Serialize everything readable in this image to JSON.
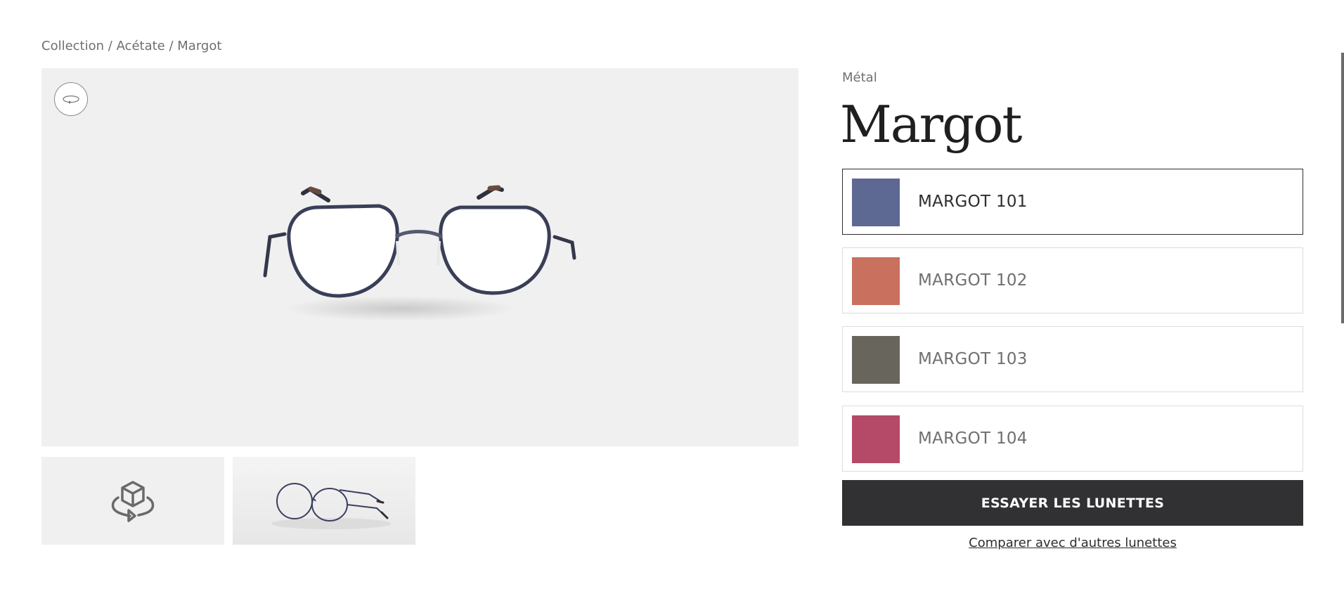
{
  "breadcrumb": {
    "items": [
      "Collection",
      "Acétate",
      "Margot"
    ],
    "separator": " / "
  },
  "viewer": {
    "rotate_icon": "rotate-360-icon",
    "product_icon": "glasses-3d-icon",
    "background": "#f0f0f0"
  },
  "thumbnails": [
    {
      "icon": "cube-rotate-icon"
    },
    {
      "icon": "glasses-photo-icon"
    }
  ],
  "product": {
    "material": "Métal",
    "title": "Margot"
  },
  "variants": [
    {
      "label": "MARGOT 101",
      "color": "#5d6893",
      "selected": true
    },
    {
      "label": "MARGOT 102",
      "color": "#c9705f",
      "selected": false
    },
    {
      "label": "MARGOT 103",
      "color": "#68655c",
      "selected": false
    },
    {
      "label": "MARGOT 104",
      "color": "#b44a67",
      "selected": false
    }
  ],
  "actions": {
    "try_label": "ESSAYER LES LUNETTES",
    "compare_label": "Comparer avec d'autres lunettes"
  }
}
